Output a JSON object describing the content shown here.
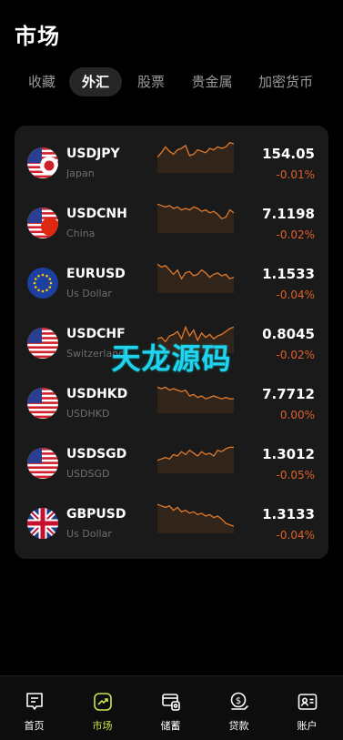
{
  "title": "市场",
  "tabs": [
    {
      "label": "收藏",
      "active": false
    },
    {
      "label": "外汇",
      "active": true
    },
    {
      "label": "股票",
      "active": false
    },
    {
      "label": "贵金属",
      "active": false
    },
    {
      "label": "加密货币",
      "active": false
    }
  ],
  "quotes": [
    {
      "symbol": "USDJPY",
      "sub": "Japan",
      "price": "154.05",
      "change": "-0.01%",
      "flag": "jp",
      "spark": [
        0.55,
        0.4,
        0.2,
        0.35,
        0.45,
        0.3,
        0.25,
        0.15,
        0.5,
        0.45,
        0.3,
        0.35,
        0.4,
        0.25,
        0.3,
        0.2,
        0.25,
        0.2,
        0.05,
        0.1
      ]
    },
    {
      "symbol": "USDCNH",
      "sub": "China",
      "price": "7.1198",
      "change": "-0.02%",
      "flag": "cn",
      "spark": [
        0.1,
        0.15,
        0.2,
        0.15,
        0.25,
        0.2,
        0.3,
        0.25,
        0.3,
        0.2,
        0.25,
        0.35,
        0.3,
        0.4,
        0.35,
        0.45,
        0.6,
        0.55,
        0.3,
        0.4
      ]
    },
    {
      "symbol": "EURUSD",
      "sub": "Us Dollar",
      "price": "1.1533",
      "change": "-0.04%",
      "flag": "eu",
      "spark": [
        0.1,
        0.2,
        0.15,
        0.3,
        0.45,
        0.3,
        0.6,
        0.4,
        0.35,
        0.5,
        0.45,
        0.3,
        0.4,
        0.55,
        0.45,
        0.4,
        0.5,
        0.45,
        0.6,
        0.55
      ]
    },
    {
      "symbol": "USDCHF",
      "sub": "Switzerland",
      "price": "0.8045",
      "change": "-0.02%",
      "flag": "us",
      "spark": [
        0.6,
        0.55,
        0.7,
        0.5,
        0.45,
        0.35,
        0.6,
        0.2,
        0.5,
        0.3,
        0.65,
        0.4,
        0.55,
        0.45,
        0.6,
        0.5,
        0.45,
        0.35,
        0.25,
        0.2
      ]
    },
    {
      "symbol": "USDHKD",
      "sub": "USDHKD",
      "price": "7.7712",
      "change": "0.00%",
      "flag": "us",
      "spark": [
        0.2,
        0.25,
        0.2,
        0.3,
        0.25,
        0.3,
        0.35,
        0.3,
        0.5,
        0.45,
        0.55,
        0.5,
        0.6,
        0.55,
        0.5,
        0.55,
        0.6,
        0.55,
        0.6,
        0.6
      ]
    },
    {
      "symbol": "USDSGD",
      "sub": "USDSGD",
      "price": "1.3012",
      "change": "-0.05%",
      "flag": "us",
      "spark": [
        0.65,
        0.6,
        0.55,
        0.6,
        0.45,
        0.5,
        0.35,
        0.45,
        0.3,
        0.4,
        0.5,
        0.35,
        0.45,
        0.4,
        0.5,
        0.3,
        0.35,
        0.25,
        0.2,
        0.2
      ]
    },
    {
      "symbol": "GBPUSD",
      "sub": "Us Dollar",
      "price": "1.3133",
      "change": "-0.04%",
      "flag": "gb",
      "spark": [
        0.1,
        0.15,
        0.2,
        0.15,
        0.3,
        0.2,
        0.35,
        0.3,
        0.4,
        0.35,
        0.45,
        0.4,
        0.5,
        0.45,
        0.55,
        0.5,
        0.6,
        0.75,
        0.8,
        0.85
      ]
    }
  ],
  "watermark": "天龙源码",
  "nav": [
    {
      "label": "首页",
      "icon": "home-icon",
      "active": false
    },
    {
      "label": "市场",
      "icon": "market-icon",
      "active": true
    },
    {
      "label": "储蓄",
      "icon": "savings-icon",
      "active": false
    },
    {
      "label": "贷款",
      "icon": "loan-icon",
      "active": false
    },
    {
      "label": "账户",
      "icon": "account-icon",
      "active": false
    }
  ],
  "colors": {
    "accent": "#c7e84a",
    "down": "#e0602a",
    "spark": "#e07a2a",
    "card": "#1a1a1a",
    "watermark": "#22d3f0"
  }
}
